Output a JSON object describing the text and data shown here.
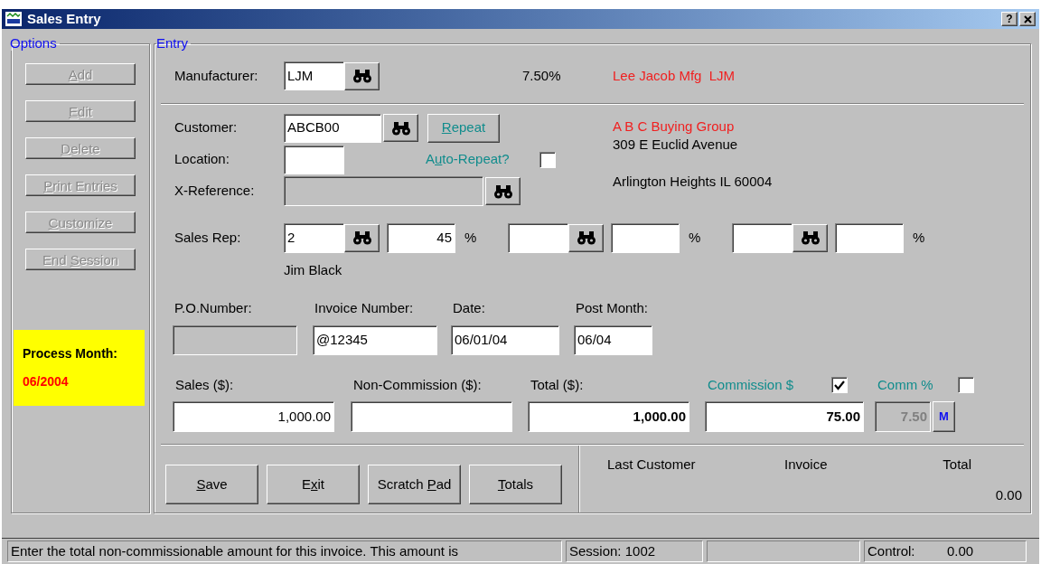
{
  "window": {
    "title": "Sales Entry",
    "help_button": "?"
  },
  "options": {
    "legend": "Options",
    "buttons": [
      {
        "label": [
          {
            "text": "A",
            "underline": true
          },
          {
            "text": "dd",
            "underline": false
          }
        ],
        "disabled": true
      },
      {
        "label": [
          {
            "text": "E",
            "underline": true
          },
          {
            "text": "dit",
            "underline": false
          }
        ],
        "disabled": true
      },
      {
        "label": [
          {
            "text": "D",
            "underline": true
          },
          {
            "text": "elete",
            "underline": false
          }
        ],
        "disabled": true
      },
      {
        "label": [
          {
            "text": "P",
            "underline": true
          },
          {
            "text": "rint Entries",
            "underline": false
          }
        ],
        "disabled": true
      },
      {
        "label": [
          {
            "text": "C",
            "underline": true
          },
          {
            "text": "ustomize",
            "underline": false
          }
        ],
        "disabled": true
      },
      {
        "label": [
          {
            "text": "End ",
            "underline": false
          },
          {
            "text": "S",
            "underline": true
          },
          {
            "text": "ession",
            "underline": false
          }
        ],
        "disabled": true
      }
    ],
    "process_month": {
      "label": "Process Month:",
      "value": "06/2004"
    }
  },
  "entry": {
    "legend": "Entry",
    "manufacturer": {
      "label": "Manufacturer:",
      "value": "LJM",
      "rate": "7.50%",
      "name": "Lee Jacob Mfg  LJM"
    },
    "customer": {
      "label": "Customer:",
      "value": "ABCB00",
      "repeat_button": [
        {
          "text": "R",
          "underline": true
        },
        {
          "text": "epeat",
          "underline": false
        }
      ],
      "name": "A B C Buying Group",
      "address": [
        "309 E Euclid Avenue",
        "Arlington Heights IL 60004"
      ]
    },
    "location": {
      "label": "Location:",
      "auto_repeat": {
        "label": [
          {
            "text": "A",
            "underline": false
          },
          {
            "text": "u",
            "underline": true
          },
          {
            "text": "to-Repeat?",
            "underline": false
          }
        ],
        "checked": false
      }
    },
    "x_reference": {
      "label": "X-Reference:",
      "disabled": true
    },
    "sales_rep": {
      "label": "Sales Rep:",
      "reps": [
        {
          "code": "2",
          "percent": "45",
          "symbol": "%"
        },
        {
          "symbol": "%"
        },
        {
          "symbol": "%"
        }
      ],
      "rep_name": "Jim Black"
    },
    "invoice": [
      {
        "label": "P.O.Number:",
        "disabled": true
      },
      {
        "label": "Invoice Number:",
        "value": "@12345",
        "disabled": false
      },
      {
        "label": "Date:",
        "value": "06/01/04",
        "disabled": false
      },
      {
        "label": "Post Month:",
        "value": "06/04",
        "disabled": false
      }
    ],
    "amounts": [
      {
        "kind": "plain",
        "label": "Sales ($):",
        "value": "1,000.00",
        "disabled": false
      },
      {
        "kind": "plain",
        "label": "Non-Commission ($):",
        "disabled": false
      },
      {
        "kind": "plain",
        "label": "Total ($):",
        "value": "1,000.00",
        "disabled": false
      },
      {
        "kind": "checkbox",
        "label": "Commission $",
        "checked": true,
        "value": "75.00",
        "disabled": false
      },
      {
        "kind": "checkbox",
        "label": "Comm %",
        "checked": false,
        "value": "7.50",
        "disabled": true,
        "button": "M"
      }
    ],
    "actions": [
      {
        "label": [
          {
            "text": "S",
            "underline": true
          },
          {
            "text": "ave",
            "underline": false
          }
        ]
      },
      {
        "label": [
          {
            "text": "E",
            "underline": false
          },
          {
            "text": "x",
            "underline": true
          },
          {
            "text": "it",
            "underline": false
          }
        ]
      },
      {
        "label": [
          {
            "text": "Scratch ",
            "underline": false
          },
          {
            "text": "P",
            "underline": true
          },
          {
            "text": "ad",
            "underline": false
          }
        ]
      },
      {
        "label": [
          {
            "text": "T",
            "underline": true
          },
          {
            "text": "otals",
            "underline": false
          }
        ]
      }
    ],
    "last_entry": {
      "columns": [
        "Last Customer",
        "Invoice",
        "Total"
      ],
      "total": "0.00"
    }
  },
  "status_bar": {
    "message": "Enter the total non-commissionable amount for this invoice. This amount is",
    "session": "Session: 1002",
    "control_label": "Control:",
    "control_value": "0.00"
  }
}
